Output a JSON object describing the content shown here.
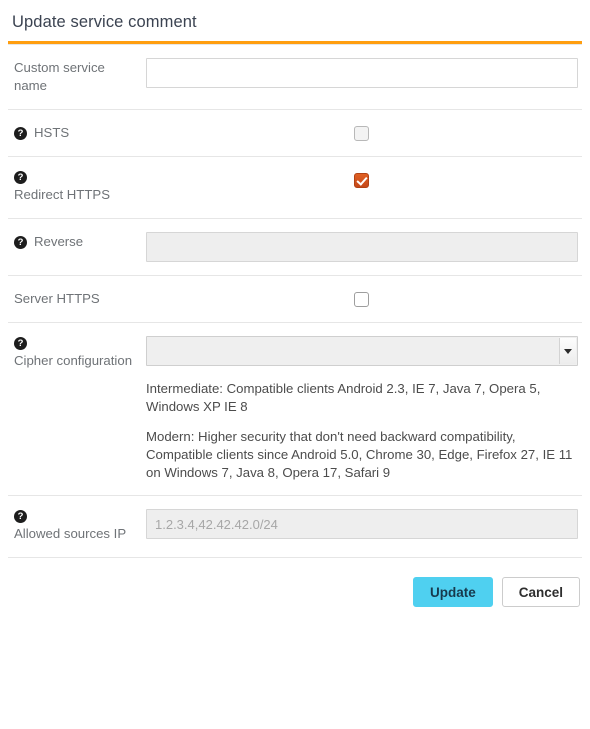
{
  "form": {
    "title": "Update service comment",
    "accent_color": "#ff9e0f",
    "help_icon_glyph": "?",
    "rows": [
      {
        "id": "custom-service-name",
        "label": "Custom service name",
        "has_help_icon": false,
        "control": "text",
        "value": "",
        "placeholder": "",
        "disabled": false
      },
      {
        "id": "hsts",
        "label": "HSTS",
        "has_help_icon": true,
        "control": "checkbox",
        "checked": false
      },
      {
        "id": "redirect-https",
        "label": "Redirect HTTPS",
        "has_help_icon": true,
        "control": "checkbox",
        "checked": true
      },
      {
        "id": "reverse",
        "label": "Reverse",
        "has_help_icon": true,
        "control": "text",
        "value": "",
        "placeholder": "",
        "disabled": true
      },
      {
        "id": "server-https",
        "label": "Server HTTPS",
        "has_help_icon": false,
        "control": "checkbox",
        "checked": false
      },
      {
        "id": "cipher-configuration",
        "label": "Cipher configuration",
        "has_help_icon": true,
        "control": "select",
        "selected_option": "",
        "help_paragraphs": [
          "Intermediate: Compatible clients Android 2.3, IE 7, Java 7, Opera 5, Windows XP IE 8",
          "Modern: Higher security that don't need backward compatibility, Compatible clients since Android 5.0, Chrome 30, Edge, Firefox 27, IE 11 on Windows 7, Java 8, Opera 17, Safari 9"
        ]
      },
      {
        "id": "allowed-sources-ip",
        "label": "Allowed sources IP",
        "has_help_icon": true,
        "control": "text",
        "value": "",
        "placeholder": "1.2.3.4,42.42.42.0/24",
        "disabled": true
      }
    ],
    "buttons": {
      "submit_label": "Update",
      "cancel_label": "Cancel",
      "submit_color": "#4fd0f0"
    }
  }
}
